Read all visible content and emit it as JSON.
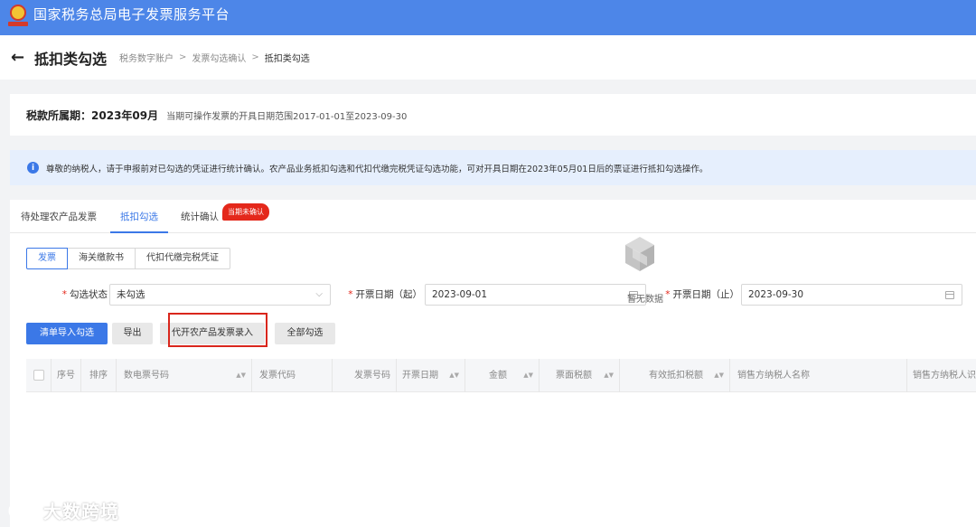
{
  "header": {
    "title": "国家税务总局电子发票服务平台",
    "emblem_icon": "national-tax-emblem-icon"
  },
  "page": {
    "title": "抵扣类勾选",
    "back_icon": "arrow-left-icon",
    "breadcrumb": [
      "税务数字账户",
      "发票勾选确认",
      "抵扣类勾选"
    ],
    "breadcrumb_sep": ">"
  },
  "period": {
    "label": "税款所属期：",
    "value": "2023年09月",
    "range_text": "当期可操作发票的开具日期范围2017-01-01至2023-09-30"
  },
  "notice": {
    "icon": "info-icon",
    "text": "尊敬的纳税人，请于申报前对已勾选的凭证进行统计确认。农产品业务抵扣勾选和代扣代缴完税凭证勾选功能，可对开具日期在2023年05月01日后的票证进行抵扣勾选操作。"
  },
  "tabs": [
    {
      "label": "待处理农产品发票",
      "active": false
    },
    {
      "label": "抵扣勾选",
      "active": true
    },
    {
      "label": "统计确认",
      "active": false
    }
  ],
  "tab_badge": "当期未确认",
  "segments": [
    {
      "label": "发票",
      "active": true
    },
    {
      "label": "海关缴款书",
      "active": false
    },
    {
      "label": "代扣代缴完税凭证",
      "active": false
    }
  ],
  "filters": {
    "status": {
      "label": "勾选状态",
      "value": "未勾选"
    },
    "date_start": {
      "label": "开票日期（起）",
      "value": "2023-09-01"
    },
    "date_end": {
      "label": "开票日期（止）",
      "value": "2023-09-30"
    },
    "required_mark": "*"
  },
  "actions": {
    "import": "清单导入勾选",
    "export": "导出",
    "agri_entry": "代开农产品发票录入",
    "select_all": "全部勾选"
  },
  "table": {
    "columns": [
      "序号",
      "排序",
      "数电票号码",
      "发票代码",
      "发票号码",
      "开票日期",
      "金额",
      "票面税额",
      "有效抵扣税额",
      "销售方纳税人名称",
      "销售方纳税人识"
    ],
    "rows": [],
    "empty_text": "暂无数据",
    "empty_icon": "empty-box-icon"
  },
  "watermark": {
    "text": "大数跨境"
  },
  "colors": {
    "header_bg": "#4d86e8",
    "primary": "#3b78e7",
    "badge": "#e4281b",
    "highlight_box": "#d9261c"
  }
}
